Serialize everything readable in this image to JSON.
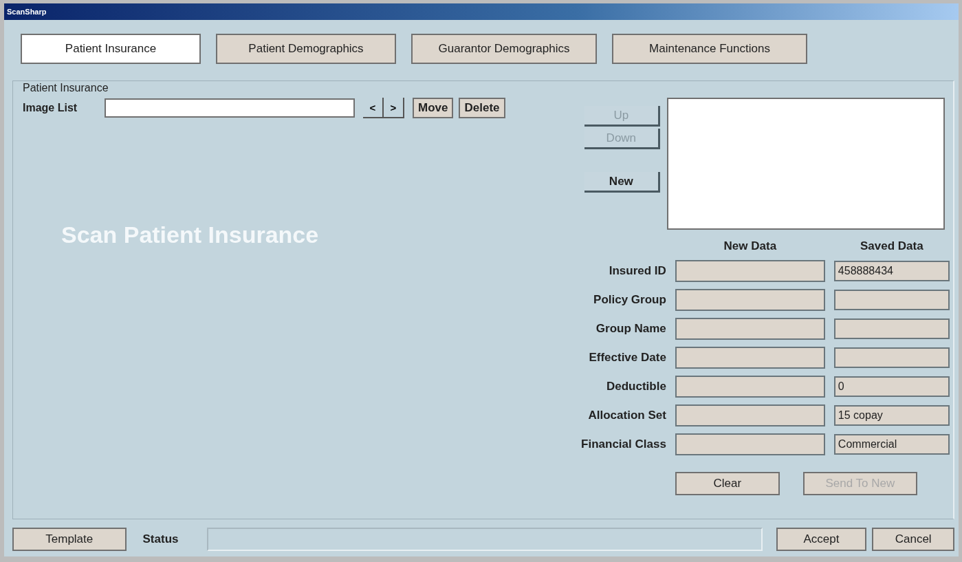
{
  "window": {
    "title": "ScanSharp"
  },
  "tabs": [
    {
      "label": "Patient Insurance",
      "selected": true
    },
    {
      "label": "Patient Demographics",
      "selected": false
    },
    {
      "label": "Guarantor Demographics",
      "selected": false
    },
    {
      "label": "Maintenance Functions",
      "selected": false
    }
  ],
  "panel": {
    "title": "Patient Insurance",
    "image_list": {
      "label": "Image List",
      "prev": "<",
      "next": ">",
      "buttons": [
        "Move",
        "Delete"
      ]
    },
    "scan_prompt": "Scan Patient Insurance",
    "list_buttons": [
      {
        "label": "Up",
        "disabled": true
      },
      {
        "label": "Down",
        "disabled": true
      },
      {
        "label": "New",
        "disabled": false
      }
    ],
    "columns": [
      "New Data",
      "Saved Data"
    ],
    "fields": [
      {
        "label": "Insured ID",
        "saved": "458888434"
      },
      {
        "label": "Policy Group"
      },
      {
        "label": "Group Name"
      },
      {
        "label": "Effective Date"
      },
      {
        "label": "Deductible",
        "saved": "0"
      },
      {
        "label": "Allocation Set",
        "saved": "15 copay"
      },
      {
        "label": "Financial Class",
        "saved": "Commercial"
      }
    ],
    "actions": [
      {
        "label": "Clear",
        "disabled": false
      },
      {
        "label": "Send To New",
        "disabled": true
      }
    ]
  },
  "footer": {
    "template": "Template",
    "status_label": "Status",
    "buttons": [
      "Accept",
      "Cancel"
    ]
  }
}
